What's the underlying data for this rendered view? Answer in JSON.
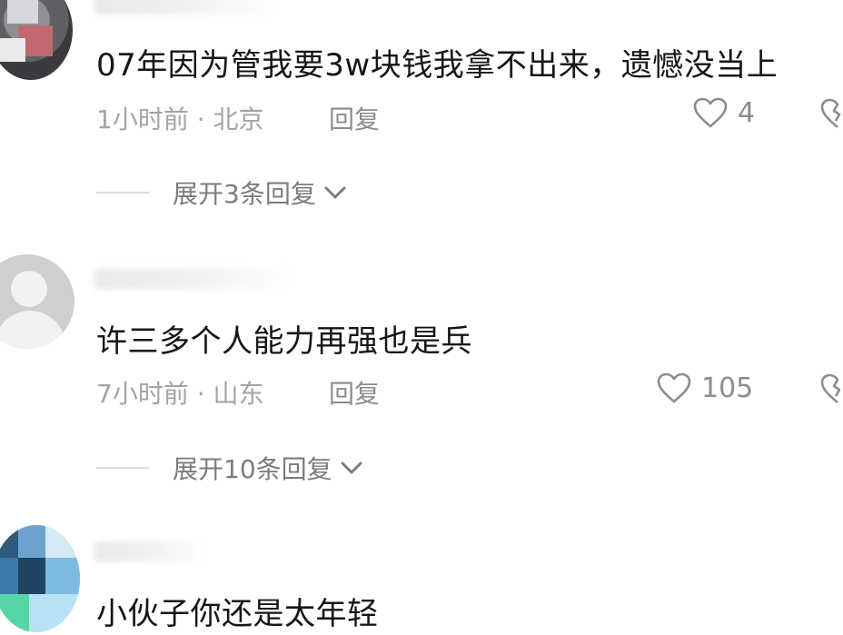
{
  "comments": [
    {
      "text": "07年因为管我要3w块钱我拿不出来，遗憾没当上",
      "time": "1小时前",
      "separator": "·",
      "location": "北京",
      "reply": "回复",
      "likes": "4",
      "expand": "展开3条回复"
    },
    {
      "text": "许三多个人能力再强也是兵",
      "time": "7小时前",
      "separator": "·",
      "location": "山东",
      "reply": "回复",
      "likes": "105",
      "expand": "展开10条回复"
    },
    {
      "text": "小伙子你还是太年轻"
    }
  ],
  "icons": {
    "like": "heart-outline-icon",
    "dislike": "broken-heart-icon",
    "expand": "chevron-down-icon"
  },
  "colors": {
    "text": "#161616",
    "meta": "#a4a4a4",
    "action": "#8c8c8c"
  }
}
